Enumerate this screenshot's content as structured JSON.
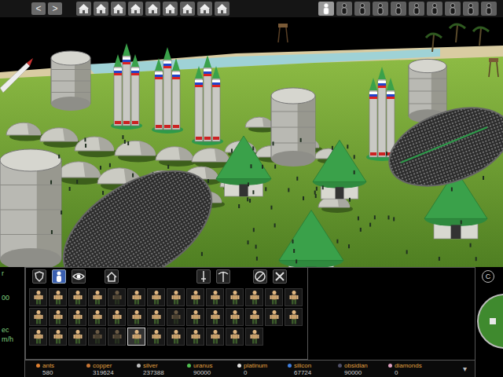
{
  "top_bar": {
    "arrows": [
      {
        "label": "<",
        "disabled": false
      },
      {
        "label": ">",
        "disabled": false
      }
    ],
    "buildings": [
      {
        "selected": false
      },
      {
        "selected": false
      },
      {
        "selected": false
      },
      {
        "selected": false
      },
      {
        "selected": false
      },
      {
        "selected": false
      },
      {
        "selected": false
      },
      {
        "selected": false
      },
      {
        "selected": false
      }
    ],
    "people": [
      {
        "selected": true
      },
      {
        "selected": false
      },
      {
        "selected": false
      },
      {
        "selected": false
      },
      {
        "selected": false
      },
      {
        "selected": false
      },
      {
        "selected": false
      },
      {
        "selected": false
      },
      {
        "selected": false
      },
      {
        "selected": false
      }
    ]
  },
  "side_panel": {
    "lines": [
      "r",
      "00",
      "ec",
      "m/h"
    ]
  },
  "toolbar": {
    "groups": [
      [
        {
          "selected": false
        },
        {
          "selected": true
        },
        {
          "selected": false
        }
      ],
      [
        {
          "selected": false
        }
      ],
      [
        {
          "selected": false
        },
        {
          "selected": false
        }
      ],
      [
        {
          "selected": false
        },
        {
          "selected": false
        }
      ]
    ]
  },
  "units": {
    "rows": [
      [
        {
          "enabled": true,
          "selected": false
        },
        {
          "enabled": true,
          "selected": false
        },
        {
          "enabled": true,
          "selected": false
        },
        {
          "enabled": true,
          "selected": false
        },
        {
          "enabled": false,
          "selected": false
        },
        {
          "enabled": true,
          "selected": false
        },
        {
          "enabled": true,
          "selected": false
        },
        {
          "enabled": true,
          "selected": false
        },
        {
          "enabled": true,
          "selected": false
        },
        {
          "enabled": true,
          "selected": false
        },
        {
          "enabled": true,
          "selected": false
        },
        {
          "enabled": true,
          "selected": false
        },
        {
          "enabled": true,
          "selected": false
        },
        {
          "enabled": true,
          "selected": false
        }
      ],
      [
        {
          "enabled": true,
          "selected": false
        },
        {
          "enabled": true,
          "selected": false
        },
        {
          "enabled": true,
          "selected": false
        },
        {
          "enabled": true,
          "selected": false
        },
        {
          "enabled": true,
          "selected": false
        },
        {
          "enabled": true,
          "selected": false
        },
        {
          "enabled": true,
          "selected": false
        },
        {
          "enabled": false,
          "selected": false
        },
        {
          "enabled": true,
          "selected": false
        },
        {
          "enabled": true,
          "selected": false
        },
        {
          "enabled": true,
          "selected": false
        },
        {
          "enabled": true,
          "selected": false
        },
        {
          "enabled": true,
          "selected": false
        },
        {
          "enabled": true,
          "selected": false
        }
      ],
      [
        {
          "enabled": true,
          "selected": false
        },
        {
          "enabled": true,
          "selected": false
        },
        {
          "enabled": true,
          "selected": false
        },
        {
          "enabled": false,
          "selected": false
        },
        {
          "enabled": false,
          "selected": false
        },
        {
          "enabled": true,
          "selected": true
        },
        {
          "enabled": true,
          "selected": false
        },
        {
          "enabled": true,
          "selected": false
        },
        {
          "enabled": true,
          "selected": false
        },
        {
          "enabled": true,
          "selected": false
        },
        {
          "enabled": true,
          "selected": false
        },
        {
          "enabled": true,
          "selected": false
        }
      ]
    ]
  },
  "resources": [
    {
      "name": "ants",
      "value": "580",
      "color": "#e08030"
    },
    {
      "name": "copper",
      "value": "319624",
      "color": "#c87533"
    },
    {
      "name": "silver",
      "value": "237388",
      "color": "#c0c0c0"
    },
    {
      "name": "uranus",
      "value": "90000",
      "color": "#50c050"
    },
    {
      "name": "platinum",
      "value": "0",
      "color": "#e5e4e2"
    },
    {
      "name": "silicon",
      "value": "67724",
      "color": "#4080e0"
    },
    {
      "name": "obsidian",
      "value": "90000",
      "color": "#505068"
    },
    {
      "name": "diamonds",
      "value": "0",
      "color": "#e0a0c0"
    }
  ],
  "more_button": "▾",
  "corner_button": "C"
}
